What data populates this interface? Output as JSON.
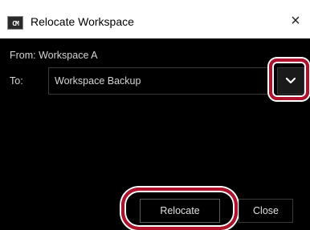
{
  "window": {
    "title": "Relocate Workspace",
    "app_icon": "app-icon",
    "app_icon_text": "CM",
    "close_glyph": "×"
  },
  "form": {
    "from_text": "From: Workspace A",
    "to_label": "To:",
    "to_value": "Workspace Backup",
    "dropdown_icon": "chevron-down-icon"
  },
  "buttons": {
    "relocate_label": "Relocate",
    "close_label": "Close"
  },
  "colors": {
    "dialog_background": "#000000",
    "highlight": "#b0112b",
    "text": "#d6d6d6"
  }
}
